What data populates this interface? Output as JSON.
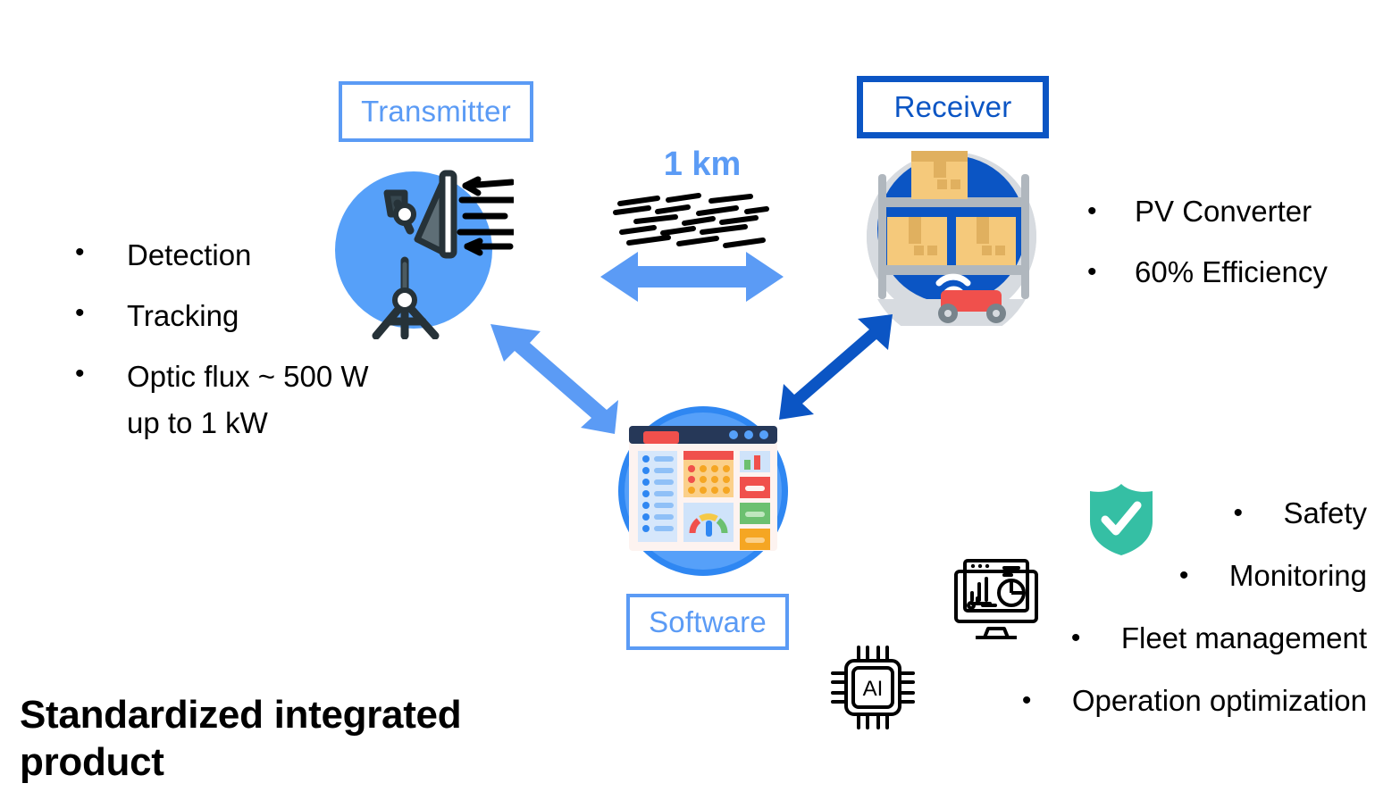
{
  "diagram": {
    "nodes": {
      "transmitter": {
        "label": "Transmitter",
        "border_color": "#5B9BF5",
        "text_color": "#5B9BF5"
      },
      "receiver": {
        "label": "Receiver",
        "border_color": "#0B55C4",
        "text_color": "#0B55C4"
      },
      "software": {
        "label": "Software",
        "border_color": "#5B9BF5",
        "text_color": "#5B9BF5"
      }
    },
    "distance": {
      "label": "1 km",
      "color": "#5B9BF5"
    },
    "transmitter_features": [
      {
        "bullet": "•",
        "text": "Detection"
      },
      {
        "bullet": "•",
        "text": "Tracking"
      },
      {
        "bullet": "•",
        "text": "Optic flux ~ 500 W\nup to 1 kW"
      }
    ],
    "receiver_features": [
      {
        "bullet": "•",
        "text": "PV Converter"
      },
      {
        "bullet": "•",
        "text": "60% Efficiency"
      }
    ],
    "software_features": [
      {
        "bullet": "•",
        "text": "Safety"
      },
      {
        "bullet": "•",
        "text": "Monitoring"
      },
      {
        "bullet": "•",
        "text": "Fleet management"
      },
      {
        "bullet": "•",
        "text": "Operation optimization"
      }
    ],
    "headline": "Standardized integrated\nproduct",
    "icons": {
      "transmitter": "satellite-dish-tripod-icon",
      "receiver": "warehouse-robot-icon",
      "software": "dashboard-window-icon",
      "beam": "laser-beam-dashes-icon",
      "shield": "shield-check-icon",
      "monitor": "monitor-analytics-icon",
      "chip": "ai-chip-icon"
    },
    "chip_label": "AI",
    "colors": {
      "light_blue": "#5B9BF5",
      "dark_blue": "#0B55C4",
      "circle_blue": "#56A0F9",
      "teal": "#35BFA4",
      "black": "#000000"
    }
  }
}
